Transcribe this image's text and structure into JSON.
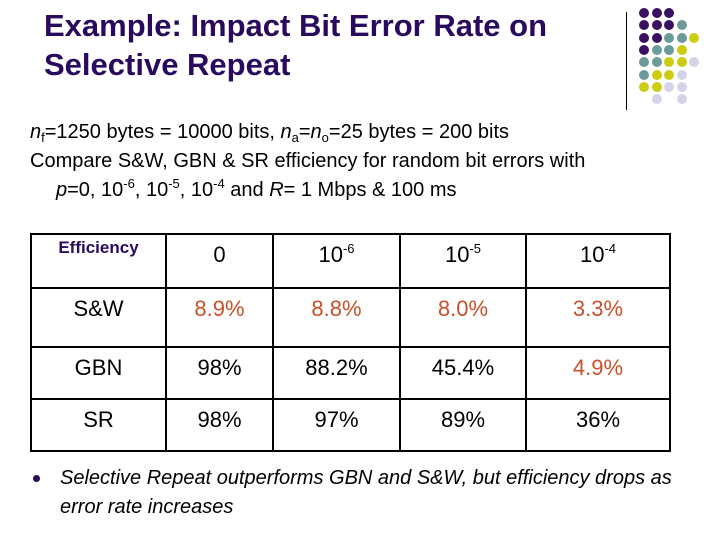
{
  "slide": {
    "title_line1": "Example:  Impact Bit Error Rate on",
    "title_line2": "Selective Repeat",
    "line1": {
      "n": "n",
      "sub_f": "f",
      "text1": "=1250 bytes = 10000 bits, ",
      "sub_a": "a",
      "eq": "=",
      "sub_o": "o",
      "text2": "=25 bytes = 200 bits"
    },
    "line2": "Compare S&W, GBN & SR efficiency for random bit errors with",
    "line3": {
      "p": "p",
      "text1": "=0, 10",
      "exp1": "-6",
      "text2": ", 10",
      "exp2": "-5",
      "text3": ", 10",
      "exp3": "-4",
      "text4": " and  ",
      "R": "R",
      "text5": "= 1 Mbps & 100 ms"
    },
    "bullet": "Selective Repeat outperforms GBN and S&W, but efficiency drops as error rate increases"
  },
  "table": {
    "header_label": "Efficiency",
    "columns": [
      {
        "base": "0",
        "exp": ""
      },
      {
        "base": "10",
        "exp": "-6"
      },
      {
        "base": "10",
        "exp": "-5"
      },
      {
        "base": "10",
        "exp": "-4"
      }
    ],
    "rows": [
      {
        "label": "S&W",
        "values": [
          "8.9%",
          "8.8%",
          "8.0%",
          "3.3%"
        ],
        "highlight": [
          true,
          true,
          true,
          true
        ]
      },
      {
        "label": "GBN",
        "values": [
          "98%",
          "88.2%",
          "45.4%",
          "4.9%"
        ],
        "highlight": [
          false,
          false,
          false,
          true
        ]
      },
      {
        "label": "SR",
        "values": [
          "98%",
          "97%",
          "89%",
          "36%"
        ],
        "highlight": [
          false,
          false,
          false,
          false
        ]
      }
    ]
  },
  "colors": {
    "title": "#2a0a5e",
    "highlight": "#c8502a",
    "dot_purple": "#3a1060",
    "dot_teal": "#6a9a9a",
    "dot_yellow": "#cccc10",
    "dot_lavender": "#d4d4e8"
  },
  "decor": {
    "dot_grid": [
      "PPP..",
      "PPPT.",
      "PPTTY",
      "PTTY.",
      "TTYYL",
      "TYYL.",
      "YYLL.",
      ".L.L."
    ]
  }
}
